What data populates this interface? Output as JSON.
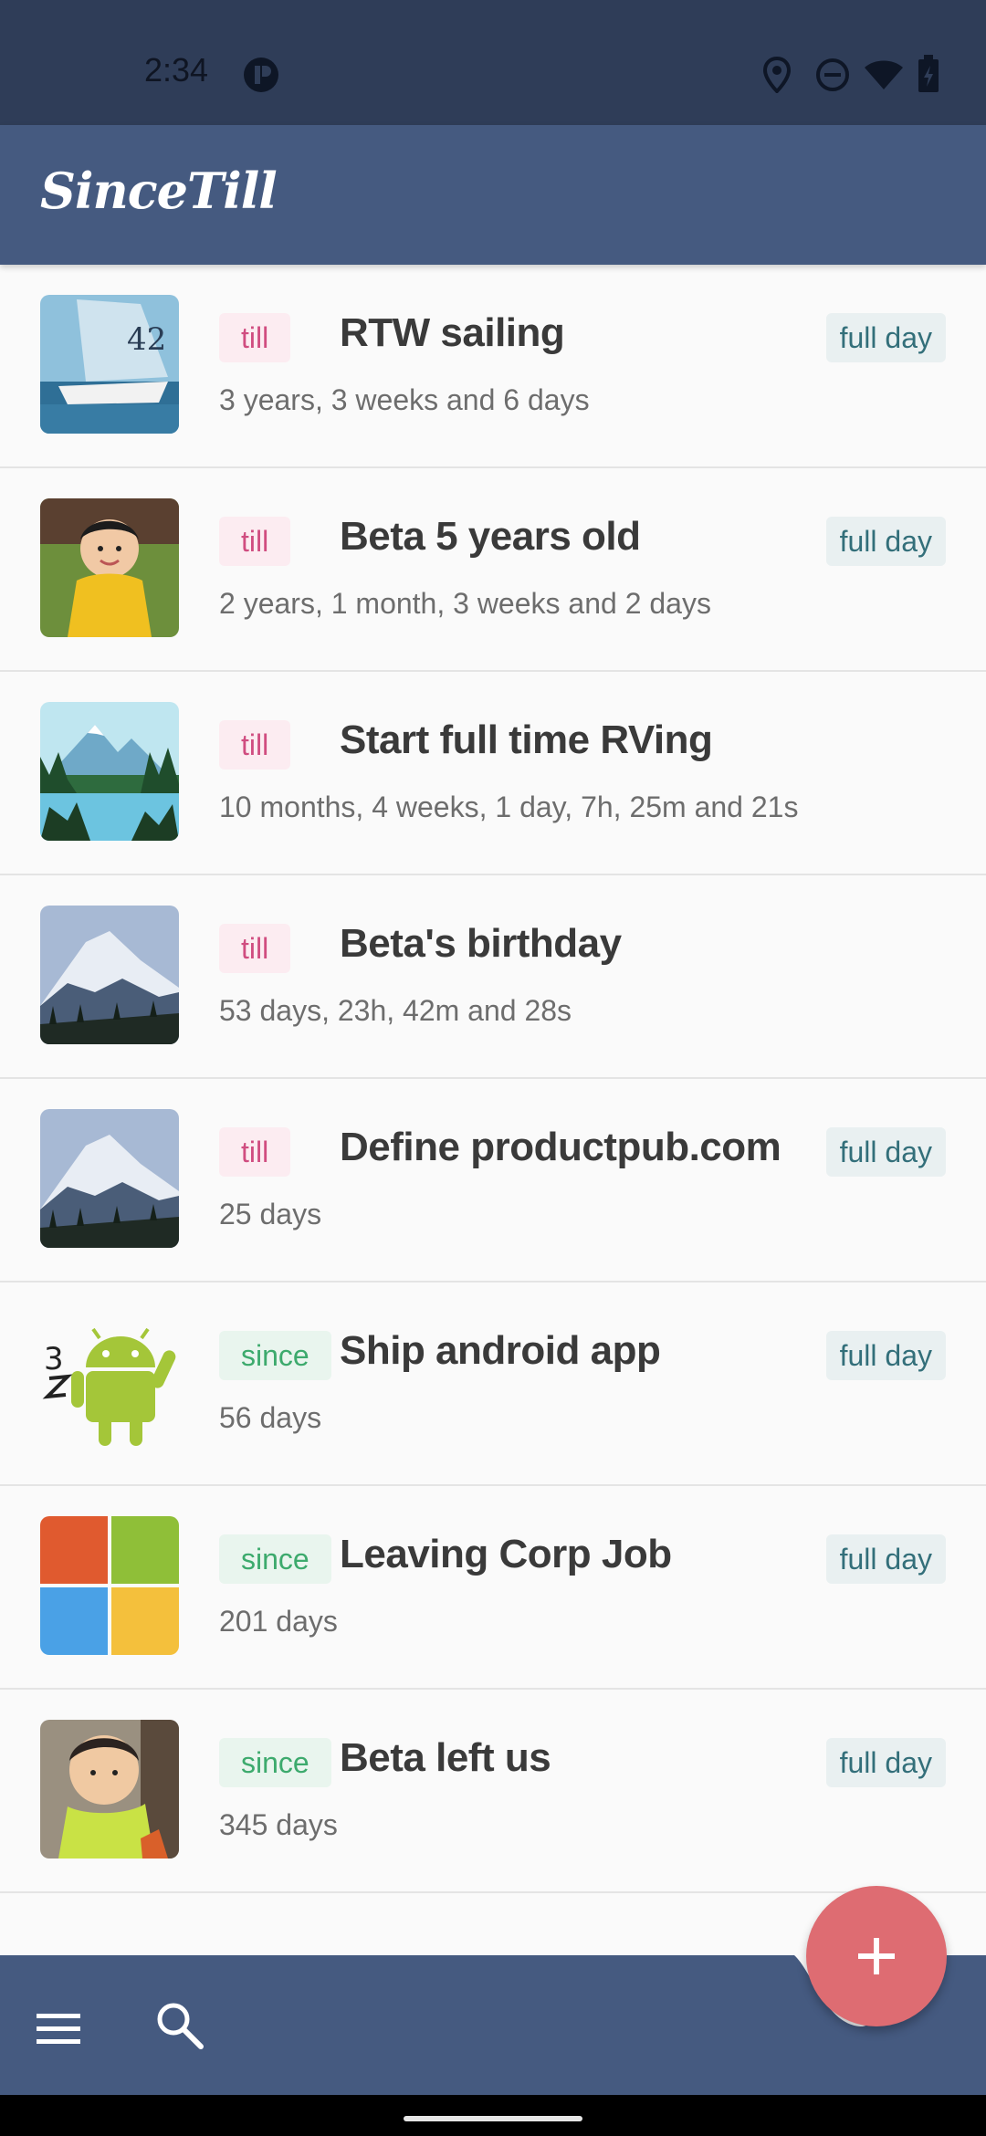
{
  "status_bar": {
    "time": "2:34",
    "icons": [
      "app-notification-icon",
      "location-icon",
      "do-not-disturb-icon",
      "wifi-icon",
      "battery-icon"
    ]
  },
  "app_bar": {
    "title": "SinceTill"
  },
  "events": [
    {
      "tag": "till",
      "title": "RTW sailing",
      "subtitle": "3 years, 3 weeks and 6 days",
      "badge": "full day",
      "thumb": "sailboat"
    },
    {
      "tag": "till",
      "title": "Beta 5 years old",
      "subtitle": "2 years, 1 month, 3 weeks and 2 days",
      "badge": "full day",
      "thumb": "toddler"
    },
    {
      "tag": "till",
      "title": "Start full time RVing",
      "subtitle": "10 months, 4 weeks, 1 day, 7h, 25m and 21s",
      "badge": "",
      "thumb": "mountain-lake"
    },
    {
      "tag": "till",
      "title": "Beta's birthday",
      "subtitle": "53 days, 23h, 42m and 28s",
      "badge": "",
      "thumb": "snowy-mountain"
    },
    {
      "tag": "till",
      "title": "Define productpub.com",
      "subtitle": "25 days",
      "badge": "full day",
      "thumb": "snowy-mountain"
    },
    {
      "tag": "since",
      "title": "Ship android app",
      "subtitle": "56 days",
      "badge": "full day",
      "thumb": "android"
    },
    {
      "tag": "since",
      "title": "Leaving Corp Job",
      "subtitle": "201 days",
      "badge": "full day",
      "thumb": "windows-logo"
    },
    {
      "tag": "since",
      "title": "Beta left us",
      "subtitle": "345 days",
      "badge": "full day",
      "thumb": "baby"
    }
  ],
  "bottom_bar": {
    "menu_icon": "menu-icon",
    "search_icon": "search-icon",
    "fab_icon": "plus-icon"
  },
  "colors": {
    "status_bar": "#2f3d58",
    "app_bar": "#455a80",
    "till_tag_text": "#d04d80",
    "since_tag_text": "#3daa6d",
    "badge_text": "#336f7a",
    "fab": "#de6c72"
  }
}
